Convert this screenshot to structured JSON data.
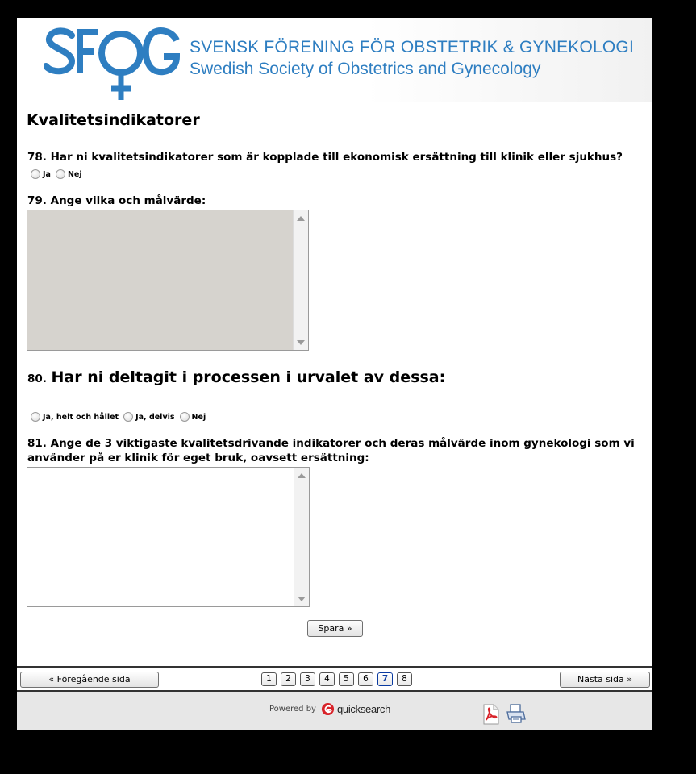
{
  "header": {
    "logo_text": "SFOG",
    "org_name_sv": "SVENSK FÖRENING FÖR OBSTETRIK & GYNEKOLOGI",
    "org_name_en": "Swedish Society of Obstetrics and Gynecology",
    "brand_color": "#2e7ec1"
  },
  "section_title": "Kvalitetsindikatorer",
  "questions": {
    "q78": {
      "label": "78. Har ni kvalitetsindikatorer som är kopplade till ekonomisk ersättning till klinik eller sjukhus?",
      "options": [
        "Ja",
        "Nej"
      ]
    },
    "q79": {
      "label": "79. Ange vilka och målvärde:",
      "value": "",
      "state": "disabled"
    },
    "q80": {
      "number": "80.",
      "label": "Har ni deltagit i processen i urvalet av dessa:",
      "options": [
        "Ja, helt och hållet",
        "Ja, delvis",
        "Nej"
      ]
    },
    "q81": {
      "label_line1": "81. Ange de 3 viktigaste kvalitetsdrivande indikatorer och deras målvärde inom gynekologi som vi",
      "label_line2": "använder på er klinik för eget bruk, oavsett ersättning:",
      "value": ""
    }
  },
  "save_button": "Spara »",
  "navigation": {
    "prev": "« Föregående sida",
    "next": "Nästa sida »",
    "pages": [
      "1",
      "2",
      "3",
      "4",
      "5",
      "6",
      "7",
      "8"
    ],
    "current_page": "7"
  },
  "footer": {
    "powered_by": "Powered by",
    "brand": "quicksearch",
    "icons": [
      "pdf-icon",
      "print-icon"
    ]
  }
}
